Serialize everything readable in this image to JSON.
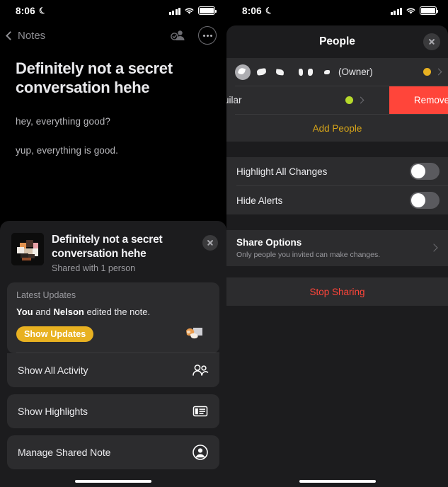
{
  "statusbar": {
    "time": "8:06",
    "moon_icon": "moon-icon",
    "signal_icon": "cellular-signal-icon",
    "wifi_icon": "wifi-icon",
    "battery_icon": "battery-icon"
  },
  "left": {
    "nav": {
      "back_label": "Notes",
      "back_icon": "chevron-left-icon",
      "collaborate_icon": "shared-person-check-icon",
      "more_icon": "more-ellipsis-icon"
    },
    "note": {
      "title": "Definitely not a secret conversation hehe",
      "lines": [
        "hey, everything good?",
        "yup, everything is good."
      ]
    },
    "sheet": {
      "thumbnail_icon": "note-photo-thumbnail",
      "title": "Definitely not a secret conversation hehe",
      "subtitle": "Shared with 1 person",
      "close_icon": "close-icon",
      "updates": {
        "label": "Latest Updates",
        "text_you": "You",
        "text_mid": " and ",
        "text_name": "Nelson",
        "text_end": " edited the note.",
        "button_label": "Show Updates",
        "button_color": "#e8b121",
        "sticker_icon": "sticker-thumbnail"
      },
      "rows": [
        {
          "label": "Show All Activity",
          "icon": "two-people-icon"
        },
        {
          "label": "Show Highlights",
          "icon": "highlight-list-icon"
        },
        {
          "label": "Manage Shared Note",
          "icon": "person-circle-icon"
        }
      ]
    }
  },
  "right": {
    "header": {
      "title": "People",
      "close_icon": "close-icon"
    },
    "people": [
      {
        "name_redacted": true,
        "owner_suffix": "(Owner)",
        "status_color": "#e8b121",
        "avatar_icon": "avatar-redacted-icon",
        "chevron_icon": "chevron-right-icon"
      },
      {
        "name": "juilar",
        "status_color": "#b6d92b",
        "chevron_icon": "chevron-right-icon",
        "remove_label": "Remove",
        "remove_color": "#ff453a"
      }
    ],
    "add_people_label": "Add People",
    "add_people_color": "#d6a419",
    "settings": [
      {
        "label": "Highlight All Changes",
        "toggle_on": false
      },
      {
        "label": "Hide Alerts",
        "toggle_on": false
      }
    ],
    "share_options": {
      "title": "Share Options",
      "subtitle": "Only people you invited can make changes.",
      "chevron_icon": "chevron-right-icon"
    },
    "stop_sharing": {
      "label": "Stop Sharing",
      "color": "#ff453a"
    }
  }
}
